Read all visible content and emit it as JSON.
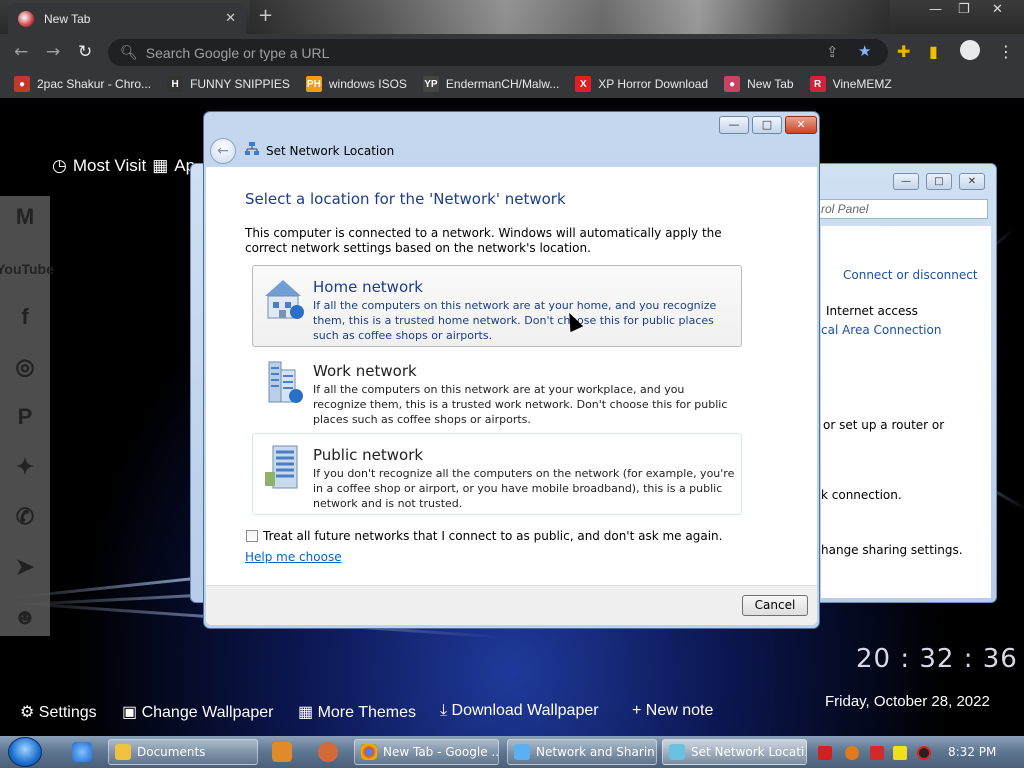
{
  "browser": {
    "tab_title": "New Tab",
    "tab_close": "✕",
    "new_tab": "+",
    "omnibox_placeholder": "Search Google or type a URL",
    "window_min": "—",
    "window_max": "❐",
    "window_close": "✕"
  },
  "bookmarks": [
    {
      "label": "2pac Shakur - Chro...",
      "icon": "2pac-icon",
      "color": "#c0392b"
    },
    {
      "label": "FUNNY SNIPPIES",
      "icon": "h-icon",
      "color": "#333333"
    },
    {
      "label": "windows ISOS",
      "icon": "ph-icon",
      "color": "#f39c12"
    },
    {
      "label": "EndermanCH/Malw...",
      "icon": "yp-icon",
      "color": "#444444"
    },
    {
      "label": "XP Horror Download",
      "icon": "x-icon",
      "color": "#e02020"
    },
    {
      "label": "New Tab",
      "icon": "newtab-icon",
      "color": "#c44466"
    },
    {
      "label": "VineMEMZ",
      "icon": "r-icon",
      "color": "#d0233a"
    }
  ],
  "newtab": {
    "most_visited": "Most Visit",
    "apps": "Ap",
    "bottom": {
      "settings": "Settings",
      "change_wallpaper": "Change Wallpaper",
      "more_themes": "More Themes",
      "download_wallpaper": "Download Wallpaper",
      "new_note": "+ New note"
    },
    "clock": "20 : 32 : 36",
    "date": "Friday, October 28, 2022"
  },
  "bg_window": {
    "search_placeholder": "rol Panel",
    "link_connect": "Connect or disconnect",
    "text_internet": "Internet access",
    "link_lan": "cal Area Connection",
    "text_router": "or set up a router or",
    "text_connection": "k connection.",
    "text_sharing": "hange sharing settings."
  },
  "dialog": {
    "title": "Set Network Location",
    "heading": "Select a location for the 'Network' network",
    "intro": "This computer is connected to a network. Windows will automatically apply the correct network settings based on the network's location.",
    "options": [
      {
        "title": "Home network",
        "desc": "If all the computers on this network are at your home, and you recognize them, this is a trusted home network.  Don't choose this for public places such as coffee shops or airports."
      },
      {
        "title": "Work network",
        "desc": "If all the computers on this network are at your workplace, and you recognize them, this is a trusted work network.  Don't choose this for public places such as coffee shops or airports."
      },
      {
        "title": "Public network",
        "desc": "If you don't recognize all the computers on the network (for example, you're in a coffee shop or airport, or you have mobile broadband), this is a public network and is not trusted."
      }
    ],
    "checkbox_label": "Treat all future networks that I connect to as public, and don't ask me again.",
    "checkbox_checked": false,
    "help_link": "Help me choose",
    "cancel": "Cancel"
  },
  "taskbar": {
    "items": [
      {
        "label": "Documents",
        "icon": "folder-icon",
        "color": "#f0c040"
      },
      {
        "label": "New Tab - Google ...",
        "icon": "chrome-icon",
        "color": "#4285f4"
      },
      {
        "label": "Network and Sharin...",
        "icon": "network-icon",
        "color": "#5ab0f0"
      },
      {
        "label": "Set Network Locati...",
        "icon": "network-location-icon",
        "color": "#6ac0e0"
      }
    ],
    "time": "8:32 PM"
  }
}
